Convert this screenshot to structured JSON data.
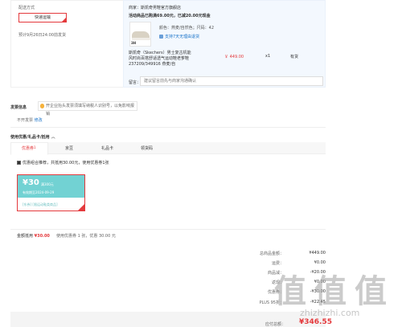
{
  "delivery": {
    "label": "配送方式",
    "button": "快递运输",
    "eta": "预计9月26日24:00前发货"
  },
  "shop": {
    "line": "商家：斯凯奇男鞋官方旗舰店",
    "promo": "活动商品已购满69.00元，已减20.00元现金",
    "spec": "颜色：燕麦/自然色；尺码：42",
    "returns": "支持7天无理由退货",
    "product": {
      "title": "斯凯奇（Skechers）男士复古机能风时尚百搭舒适透气运动鞋老爹鞋237209/349916 燕麦/自",
      "image_tag": "3H",
      "price": "￥ 449.00",
      "qty": "x1",
      "stock": "有货"
    },
    "remark_label": "留言：",
    "remark_placeholder": "建议留言前先与商家沟通确认"
  },
  "invoice": {
    "title": "发票信息",
    "tip": "开企业抬头发票须填写纳税人识别号，以免影响报销",
    "status": "不开发票",
    "edit": "修改"
  },
  "coupons": {
    "title": "使用优惠/礼品卡/抵用",
    "toggle": "︿",
    "tabs": [
      {
        "label": "优惠券",
        "sup": "1"
      },
      {
        "label": "京豆"
      },
      {
        "label": "礼品卡"
      },
      {
        "label": "领货码"
      }
    ],
    "checkbox_label": "优惠组合推荐，共抵用30.00元，使用优惠券1张",
    "card": {
      "amount": "¥30",
      "condition": "满300元",
      "expiry": "有效期至2024-09-29",
      "note": "[东券] [限运动鞋类商品]"
    },
    "used_label": "金额抵用",
    "used_amount": "¥30.00",
    "summary": "使用优惠券 1 张，优惠 30.00 元"
  },
  "summary": {
    "rows": [
      {
        "label": "总商品金额：",
        "value": "¥449.00"
      },
      {
        "label": "运费：",
        "value": "¥0.00"
      },
      {
        "label": "商品减：",
        "value": "-¥20.00"
      },
      {
        "label": "返现：",
        "value": "¥0.00"
      },
      {
        "label": "优惠券：",
        "value": "-¥30.00"
      },
      {
        "label": "PLUS 95折：",
        "value": "-¥22.45"
      }
    ],
    "payable_label": "应付总额：",
    "payable_value": "¥346.55"
  },
  "watermark": {
    "chars": [
      "值",
      "值",
      "值"
    ],
    "url": "zhizhizhi.com"
  },
  "colors": {
    "accent": "#e4393c",
    "coupon": "#72d2d3",
    "link": "#1a73c9"
  }
}
